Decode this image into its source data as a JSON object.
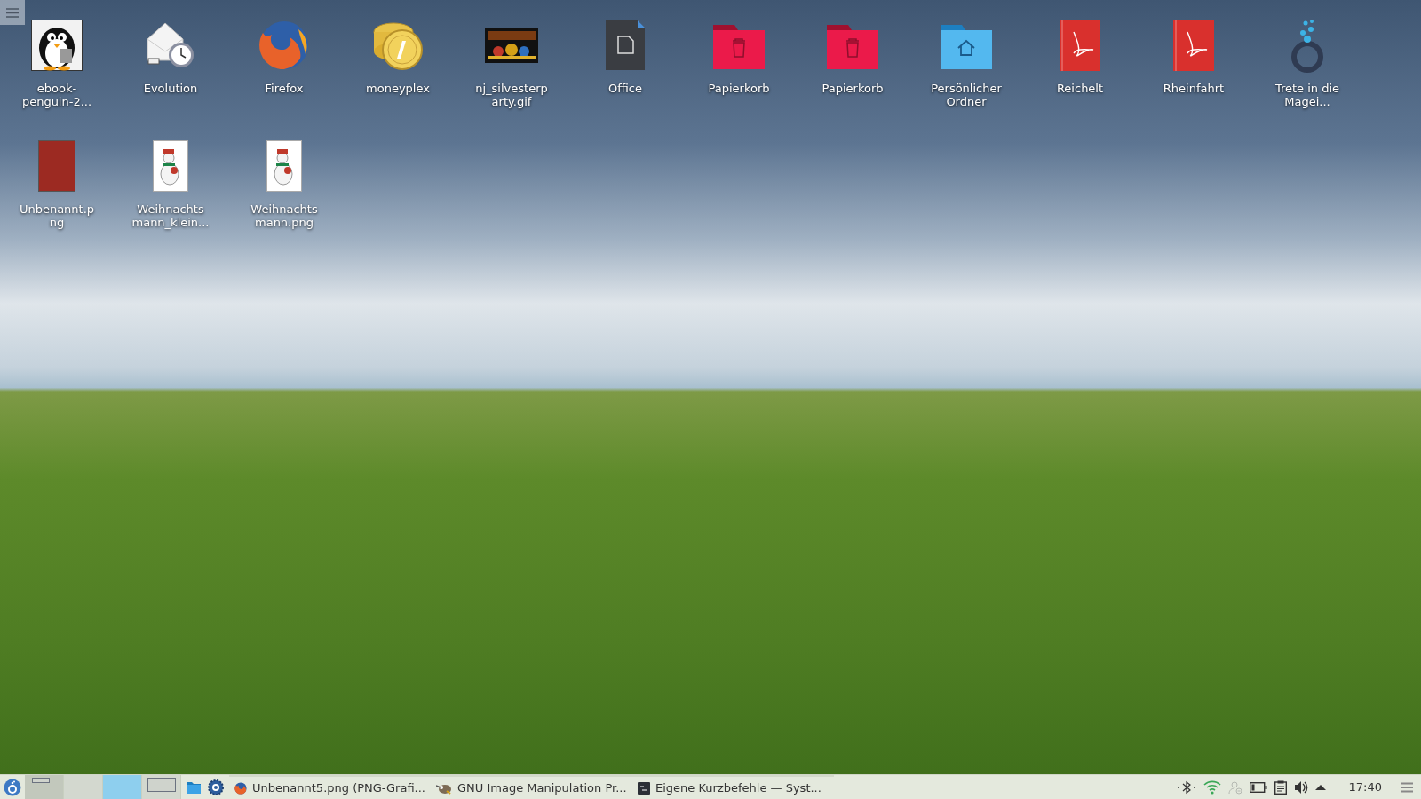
{
  "desktop_icons": [
    {
      "kind": "penguin",
      "label": "ebook-\npenguin-2..."
    },
    {
      "kind": "mail-clock",
      "label": "Evolution"
    },
    {
      "kind": "browser",
      "label": "Firefox"
    },
    {
      "kind": "coins",
      "label": "moneyplex"
    },
    {
      "kind": "image",
      "label": "nj_silvesterp\narty.gif"
    },
    {
      "kind": "document",
      "label": "Office"
    },
    {
      "kind": "trash",
      "label": "Papierkorb"
    },
    {
      "kind": "trash",
      "label": "Papierkorb"
    },
    {
      "kind": "home",
      "label": "Persönlicher\nOrdner"
    },
    {
      "kind": "pdf",
      "label": "Reichelt"
    },
    {
      "kind": "pdf",
      "label": "Rheinfahrt"
    },
    {
      "kind": "ring",
      "label": "Trete in die\nMagei..."
    },
    {
      "kind": "photo",
      "label": "Unbenannt.p\nng"
    },
    {
      "kind": "snowman",
      "label": "Weihnachts\nmann_klein..."
    },
    {
      "kind": "snowman",
      "label": "Weihnachts\nmann.png"
    }
  ],
  "taskbar": {
    "pager": [
      {
        "kind": "small",
        "selected": false
      },
      {
        "kind": "empty",
        "selected": false
      },
      {
        "kind": "empty",
        "selected": true
      },
      {
        "kind": "large",
        "selected": false
      }
    ],
    "launchers": [
      {
        "kind": "folder"
      },
      {
        "kind": "gear"
      }
    ],
    "tasks": [
      {
        "kind": "browser",
        "label": "Unbenannt5.png (PNG-Grafi..."
      },
      {
        "kind": "gimp",
        "label": "GNU Image Manipulation Pr..."
      },
      {
        "kind": "terminal",
        "label": "Eigene Kurzbefehle  — Syst..."
      }
    ],
    "tray": [
      {
        "kind": "bluetooth"
      },
      {
        "kind": "wifi"
      },
      {
        "kind": "user"
      },
      {
        "kind": "battery"
      },
      {
        "kind": "clipboard"
      },
      {
        "kind": "volume"
      },
      {
        "kind": "expand"
      }
    ],
    "clock": "17:40"
  }
}
